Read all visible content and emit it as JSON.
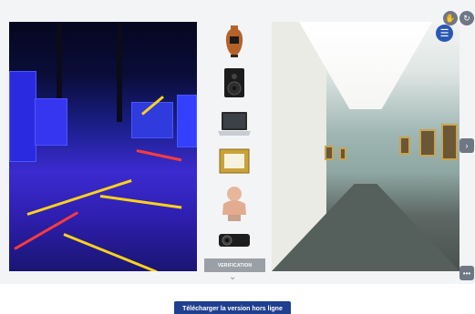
{
  "verification": {
    "label": "VERIFICATION"
  },
  "download": {
    "label": "Télécharger la version hors ligne"
  },
  "icons": {
    "hand": "hand-icon",
    "rotate": "rotate-icon",
    "menu": "menu-icon",
    "next": "chevron-right-icon",
    "more": "more-icon",
    "scroll": "chevron-down-icon"
  },
  "objects": [
    "amphora",
    "speaker",
    "laptop",
    "gilded-frame",
    "bust",
    "projector"
  ],
  "colors": {
    "accent": "#1f3f8f",
    "control": "#6f7784",
    "menu": "#2b57b8"
  }
}
